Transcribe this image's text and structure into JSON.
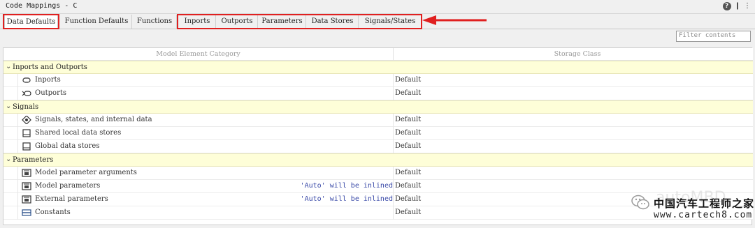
{
  "window": {
    "title": "Code Mappings - C",
    "help_icon": "?",
    "pin_icon": "❙",
    "menu_icon": "⋮"
  },
  "tabs": [
    {
      "label": "Data Defaults",
      "active": true
    },
    {
      "label": "Function Defaults",
      "active": false
    },
    {
      "label": "Functions",
      "active": false
    },
    {
      "label": "Inports",
      "active": false
    },
    {
      "label": "Outports",
      "active": false
    },
    {
      "label": "Parameters",
      "active": false
    },
    {
      "label": "Data Stores",
      "active": false
    },
    {
      "label": "Signals/States",
      "active": false
    }
  ],
  "filter": {
    "placeholder": "Filter contents",
    "value": ""
  },
  "table": {
    "columns": {
      "category": "Model Element Category",
      "storage_class": "Storage Class"
    },
    "groups": [
      {
        "label": "Inports and Outports",
        "rows": [
          {
            "icon": "inport-icon",
            "label": "Inports",
            "note": "",
            "value": "Default"
          },
          {
            "icon": "outport-icon",
            "label": "Outports",
            "note": "",
            "value": "Default"
          }
        ]
      },
      {
        "label": "Signals",
        "rows": [
          {
            "icon": "signal-icon",
            "label": "Signals, states, and internal data",
            "note": "",
            "value": "Default"
          },
          {
            "icon": "data-store-icon",
            "label": "Shared local data stores",
            "note": "",
            "value": "Default"
          },
          {
            "icon": "data-store-icon",
            "label": "Global data stores",
            "note": "",
            "value": "Default"
          }
        ]
      },
      {
        "label": "Parameters",
        "rows": [
          {
            "icon": "parameter-icon",
            "label": "Model parameter arguments",
            "note": "",
            "value": "Default"
          },
          {
            "icon": "parameter-icon",
            "label": "Model parameters",
            "note": "'Auto' will be inlined",
            "value": "Default"
          },
          {
            "icon": "parameter-icon",
            "label": "External parameters",
            "note": "'Auto' will be inlined",
            "value": "Default"
          },
          {
            "icon": "constant-icon",
            "label": "Constants",
            "note": "",
            "value": "Default"
          }
        ]
      }
    ]
  },
  "watermark": {
    "faint_text": "autoMBD",
    "name": "中国汽车工程师之家",
    "url": "www.cartech8.com"
  },
  "colors": {
    "annotation_red": "#e02020",
    "group_bg": "#fefed8",
    "note_blue": "#3a4aa8"
  }
}
